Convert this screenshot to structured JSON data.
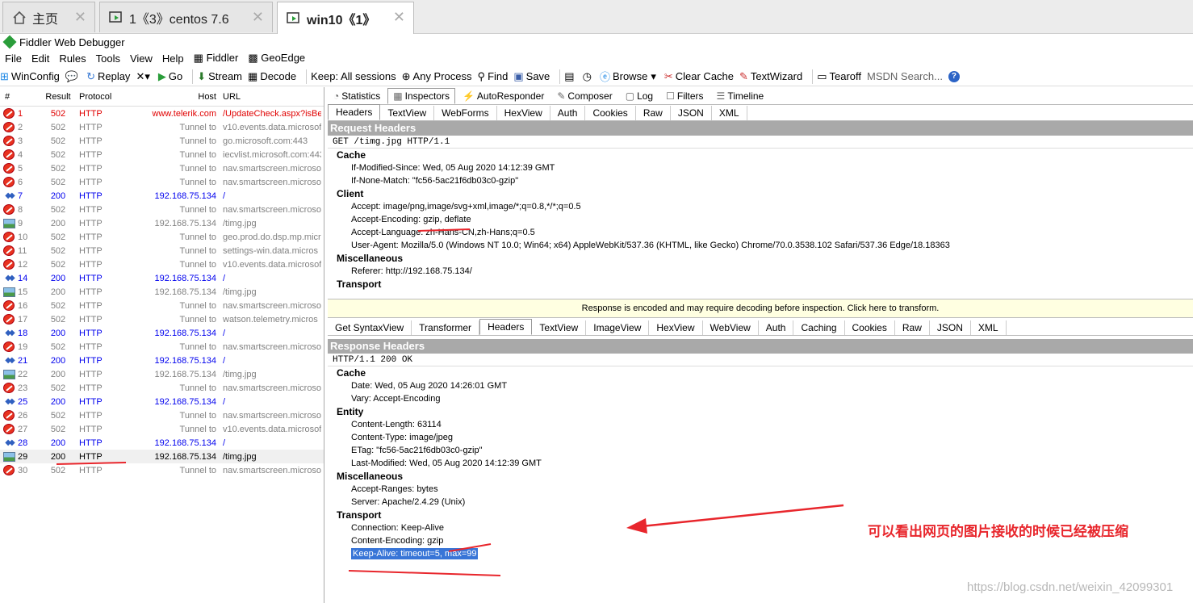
{
  "host_tabs": [
    {
      "label": "主页",
      "icon": "home-icon"
    },
    {
      "label": "1《3》centos 7.6",
      "icon": "vm-icon"
    },
    {
      "label": "win10《1》",
      "icon": "vm-icon"
    }
  ],
  "app_title": "Fiddler Web Debugger",
  "menu": [
    "File",
    "Edit",
    "Rules",
    "Tools",
    "View",
    "Help",
    "Fiddler",
    "GeoEdge"
  ],
  "toolbar": {
    "winconfig": "WinConfig",
    "replay": "Replay",
    "go": "Go",
    "stream": "Stream",
    "decode": "Decode",
    "keep": "Keep: All sessions",
    "process": "Any Process",
    "find": "Find",
    "save": "Save",
    "browse": "Browse",
    "clear_cache": "Clear Cache",
    "textwizard": "TextWizard",
    "tearoff": "Tearoff",
    "msdn": "MSDN Search..."
  },
  "session_headers": {
    "num": "#",
    "result": "Result",
    "protocol": "Protocol",
    "host": "Host",
    "url": "URL"
  },
  "sessions": [
    {
      "n": "1",
      "r": "502",
      "p": "HTTP",
      "h": "www.telerik.com",
      "u": "/UpdateCheck.aspx?isBet",
      "t": "red",
      "i": "block"
    },
    {
      "n": "2",
      "r": "502",
      "p": "HTTP",
      "h": "Tunnel to",
      "u": "v10.events.data.microsof",
      "t": "gray",
      "i": "block"
    },
    {
      "n": "3",
      "r": "502",
      "p": "HTTP",
      "h": "Tunnel to",
      "u": "go.microsoft.com:443",
      "t": "gray",
      "i": "block"
    },
    {
      "n": "4",
      "r": "502",
      "p": "HTTP",
      "h": "Tunnel to",
      "u": "iecvlist.microsoft.com:443",
      "t": "gray",
      "i": "block"
    },
    {
      "n": "5",
      "r": "502",
      "p": "HTTP",
      "h": "Tunnel to",
      "u": "nav.smartscreen.microso",
      "t": "gray",
      "i": "block"
    },
    {
      "n": "6",
      "r": "502",
      "p": "HTTP",
      "h": "Tunnel to",
      "u": "nav.smartscreen.microso",
      "t": "gray",
      "i": "block"
    },
    {
      "n": "7",
      "r": "200",
      "p": "HTTP",
      "h": "192.168.75.134",
      "u": "/",
      "t": "blue",
      "i": "diamond"
    },
    {
      "n": "8",
      "r": "502",
      "p": "HTTP",
      "h": "Tunnel to",
      "u": "nav.smartscreen.microso",
      "t": "gray",
      "i": "block"
    },
    {
      "n": "9",
      "r": "200",
      "p": "HTTP",
      "h": "192.168.75.134",
      "u": "/timg.jpg",
      "t": "gray",
      "i": "image"
    },
    {
      "n": "10",
      "r": "502",
      "p": "HTTP",
      "h": "Tunnel to",
      "u": "geo.prod.do.dsp.mp.micr",
      "t": "gray",
      "i": "block"
    },
    {
      "n": "11",
      "r": "502",
      "p": "HTTP",
      "h": "Tunnel to",
      "u": "settings-win.data.micros",
      "t": "gray",
      "i": "block"
    },
    {
      "n": "12",
      "r": "502",
      "p": "HTTP",
      "h": "Tunnel to",
      "u": "v10.events.data.microsof",
      "t": "gray",
      "i": "block"
    },
    {
      "n": "14",
      "r": "200",
      "p": "HTTP",
      "h": "192.168.75.134",
      "u": "/",
      "t": "blue",
      "i": "diamond"
    },
    {
      "n": "15",
      "r": "200",
      "p": "HTTP",
      "h": "192.168.75.134",
      "u": "/timg.jpg",
      "t": "gray",
      "i": "image"
    },
    {
      "n": "16",
      "r": "502",
      "p": "HTTP",
      "h": "Tunnel to",
      "u": "nav.smartscreen.microso",
      "t": "gray",
      "i": "block"
    },
    {
      "n": "17",
      "r": "502",
      "p": "HTTP",
      "h": "Tunnel to",
      "u": "watson.telemetry.micros",
      "t": "gray",
      "i": "block"
    },
    {
      "n": "18",
      "r": "200",
      "p": "HTTP",
      "h": "192.168.75.134",
      "u": "/",
      "t": "blue",
      "i": "diamond"
    },
    {
      "n": "19",
      "r": "502",
      "p": "HTTP",
      "h": "Tunnel to",
      "u": "nav.smartscreen.microso",
      "t": "gray",
      "i": "block"
    },
    {
      "n": "21",
      "r": "200",
      "p": "HTTP",
      "h": "192.168.75.134",
      "u": "/",
      "t": "blue",
      "i": "diamond"
    },
    {
      "n": "22",
      "r": "200",
      "p": "HTTP",
      "h": "192.168.75.134",
      "u": "/timg.jpg",
      "t": "gray",
      "i": "image"
    },
    {
      "n": "23",
      "r": "502",
      "p": "HTTP",
      "h": "Tunnel to",
      "u": "nav.smartscreen.microso",
      "t": "gray",
      "i": "block"
    },
    {
      "n": "25",
      "r": "200",
      "p": "HTTP",
      "h": "192.168.75.134",
      "u": "/",
      "t": "blue",
      "i": "diamond"
    },
    {
      "n": "26",
      "r": "502",
      "p": "HTTP",
      "h": "Tunnel to",
      "u": "nav.smartscreen.microso",
      "t": "gray",
      "i": "block"
    },
    {
      "n": "27",
      "r": "502",
      "p": "HTTP",
      "h": "Tunnel to",
      "u": "v10.events.data.microsof",
      "t": "gray",
      "i": "block"
    },
    {
      "n": "28",
      "r": "200",
      "p": "HTTP",
      "h": "192.168.75.134",
      "u": "/",
      "t": "blue",
      "i": "diamond"
    },
    {
      "n": "29",
      "r": "200",
      "p": "HTTP",
      "h": "192.168.75.134",
      "u": "/timg.jpg",
      "t": "sel",
      "i": "image"
    },
    {
      "n": "30",
      "r": "502",
      "p": "HTTP",
      "h": "Tunnel to",
      "u": "nav.smartscreen.microso",
      "t": "gray",
      "i": "block"
    }
  ],
  "inspector_tabs": [
    "Statistics",
    "Inspectors",
    "AutoResponder",
    "Composer",
    "Log",
    "Filters",
    "Timeline"
  ],
  "request_view_tabs": [
    "Headers",
    "TextView",
    "WebForms",
    "HexView",
    "Auth",
    "Cookies",
    "Raw",
    "JSON",
    "XML"
  ],
  "request": {
    "title": "Request Headers",
    "line": "GET /timg.jpg HTTP/1.1",
    "groups": [
      {
        "name": "Cache",
        "headers": [
          "If-Modified-Since: Wed, 05 Aug 2020 14:12:39 GMT",
          "If-None-Match: \"fc56-5ac21f6db03c0-gzip\""
        ]
      },
      {
        "name": "Client",
        "headers": [
          "Accept: image/png,image/svg+xml,image/*;q=0.8,*/*;q=0.5",
          "Accept-Encoding: gzip, deflate",
          "Accept-Language: zh-Hans-CN,zh-Hans;q=0.5",
          "User-Agent: Mozilla/5.0 (Windows NT 10.0; Win64; x64) AppleWebKit/537.36 (KHTML, like Gecko) Chrome/70.0.3538.102 Safari/537.36 Edge/18.18363"
        ]
      },
      {
        "name": "Miscellaneous",
        "headers": [
          "Referer: http://192.168.75.134/"
        ]
      },
      {
        "name": "Transport",
        "headers": []
      }
    ]
  },
  "decode_notice": "Response is encoded and may require decoding before inspection. Click here to transform.",
  "response_view_tabs": [
    "Get SyntaxView",
    "Transformer",
    "Headers",
    "TextView",
    "ImageView",
    "HexView",
    "WebView",
    "Auth",
    "Caching",
    "Cookies",
    "Raw",
    "JSON",
    "XML"
  ],
  "response": {
    "title": "Response Headers",
    "line": "HTTP/1.1 200 OK",
    "groups": [
      {
        "name": "Cache",
        "headers": [
          "Date: Wed, 05 Aug 2020 14:26:01 GMT",
          "Vary: Accept-Encoding"
        ]
      },
      {
        "name": "Entity",
        "headers": [
          "Content-Length: 63114",
          "Content-Type: image/jpeg",
          "ETag: \"fc56-5ac21f6db03c0-gzip\"",
          "Last-Modified: Wed, 05 Aug 2020 14:12:39 GMT"
        ]
      },
      {
        "name": "Miscellaneous",
        "headers": [
          "Accept-Ranges: bytes",
          "Server: Apache/2.4.29 (Unix)"
        ]
      },
      {
        "name": "Transport",
        "headers": [
          "Connection: Keep-Alive",
          "Content-Encoding: gzip",
          "Keep-Alive: timeout=5, max=99"
        ]
      }
    ]
  },
  "annotation": "可以看出网页的图片接收的时候已经被压缩",
  "watermark": "https://blog.csdn.net/weixin_42099301",
  "colors": {
    "annotation": "#e8262c",
    "highlight": "#3875d7"
  }
}
